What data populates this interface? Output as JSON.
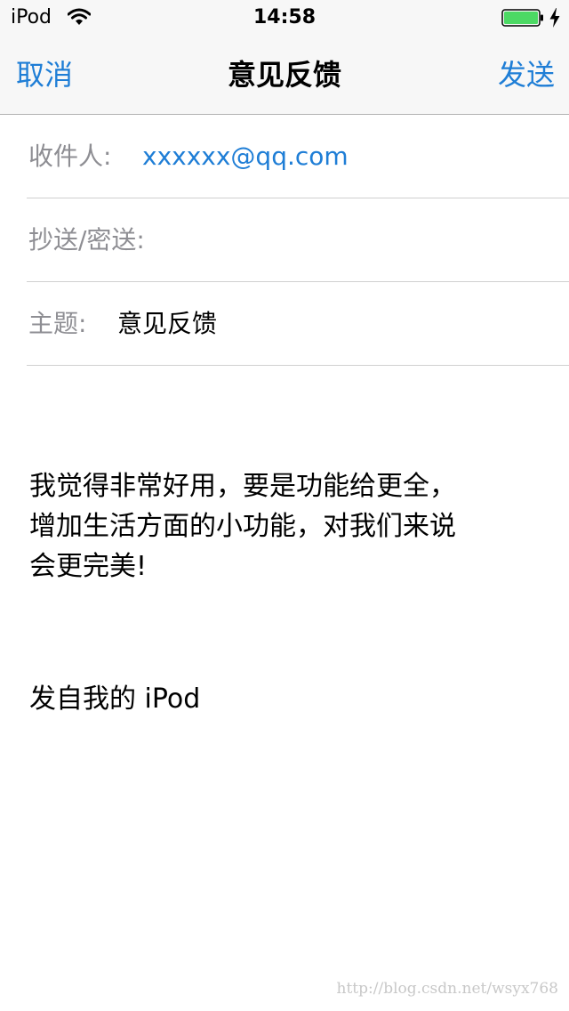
{
  "status_bar": {
    "carrier": "iPod",
    "time": "14:58",
    "wifi_icon": "wifi-icon",
    "battery_icon": "battery-icon",
    "charging_icon": "charging-bolt-icon",
    "battery_level": 1.0,
    "battery_color": "#4cd964"
  },
  "nav": {
    "cancel_label": "取消",
    "title": "意见反馈",
    "send_label": "发送",
    "accent_color": "#1f7ed6"
  },
  "fields": {
    "to": {
      "label": "收件人:",
      "value": "xxxxxx@qq.com"
    },
    "cc": {
      "label": "抄送/密送:",
      "value": ""
    },
    "subject": {
      "label": "主题:",
      "value": "意见反馈"
    }
  },
  "body": {
    "text": "我觉得非常好用，要是功能给更全，\n增加生活方面的小功能，对我们来说\n会更完美!",
    "signature": "发自我的 iPod"
  },
  "watermark": "http://blog.csdn.net/wsyx768"
}
